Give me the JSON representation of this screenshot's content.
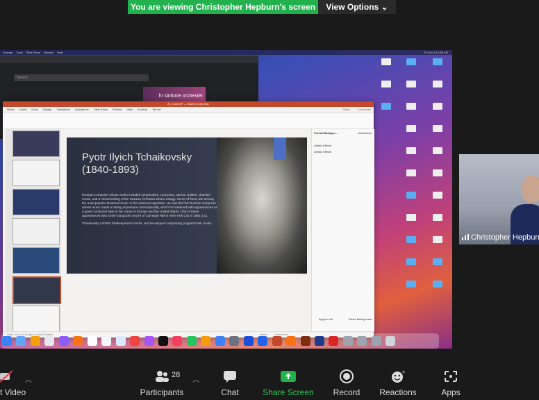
{
  "banner": {
    "viewing": "You are viewing Christopher Hepburn's screen",
    "view_options": "View Options ⌄"
  },
  "mac": {
    "menu": [
      "Arrange",
      "Tools",
      "Slide Show",
      "Window",
      "Help"
    ],
    "time": "Fri Dec 10  9:55 AM"
  },
  "browser": {
    "search_placeholder": "Search",
    "thumb_text": "hr sinfonie orchester"
  },
  "ppt": {
    "file": "AI_ConcertF — Saved to my Mac",
    "tabs": [
      "Home",
      "Insert",
      "Draw",
      "Design",
      "Transitions",
      "Animations",
      "Slide Show",
      "Review",
      "View",
      "Acrobat",
      "Tell me"
    ],
    "share": "Share",
    "comments": "Comments",
    "slide_title": "Pyotr Ilyich Tchaikovsky (1840-1893)",
    "slide_body_1": "Russian composer whose works included symphonies, concertos, operas, ballets, chamber music, and a choral setting of the Russian Orthodox Divine Liturgy. Some of these are among the most popular theatrical music in the classical repertoire. He was the first Russian composer whose music made a lasting impression internationally, which he bolstered with appearances as a guest conductor later in his career in Europe and the United States. One of these appearances was at the inaugural concert of Carnegie Hall in New York City in 1891 (LL).",
    "slide_body_2": "Tchaikovsky LOVED Shakespeare's works, and he enjoyed composing programmatic music.",
    "panel_title": "Format Backgro...",
    "panel_tab": "Animations",
    "panel_item1": "Artistic Effects",
    "panel_item2": "Artistic Effects",
    "apply_all": "Apply to All",
    "reset_bg": "Reset Background",
    "status": "Slide 15 of 36   English (United States)",
    "notes": "Notes",
    "comments_status": "Comments"
  },
  "participant": {
    "name": "Christopher Hepburn"
  },
  "toolbar": {
    "stop_video": "t Video",
    "participants": "Participants",
    "participants_count": "28",
    "chat": "Chat",
    "share_screen": "Share Screen",
    "record": "Record",
    "reactions": "Reactions",
    "apps": "Apps"
  },
  "colors": {
    "banner_green": "#23b14d",
    "share_green": "#23b14d",
    "ppt_accent": "#c4482a"
  }
}
